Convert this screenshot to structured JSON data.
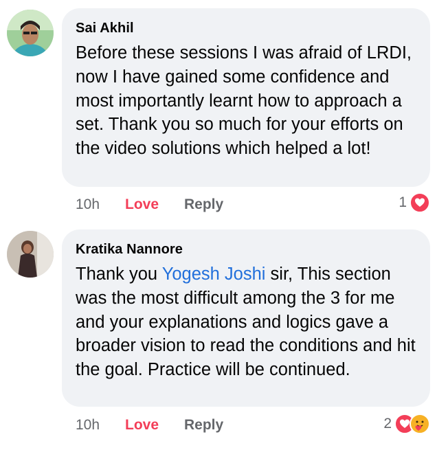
{
  "comments": [
    {
      "author": "Sai Akhil",
      "text": "Before these sessions I was afraid of LRDI, now I have gained some confidence and most importantly learnt how to approach a set. Thank you so much for your efforts on the video solutions which helped a lot!",
      "time": "10h",
      "love_label": "Love",
      "reply_label": "Reply",
      "reaction_count": "1",
      "reactions": [
        "heart-icon"
      ]
    },
    {
      "author": "Kratika Nannore",
      "text_before": "Thank you ",
      "mention": "Yogesh Joshi",
      "text_after": " sir, This section was the most difficult among the 3 for me and your explanations and logics gave a broader vision to read the conditions and hit the goal. Practice will be continued.",
      "time": "10h",
      "love_label": "Love",
      "reply_label": "Reply",
      "reaction_count": "2",
      "reactions": [
        "heart-icon",
        "care-icon"
      ]
    }
  ],
  "colors": {
    "bubble": "#f0f2f5",
    "love": "#f33e58",
    "mention": "#216fdb",
    "meta": "#65676b"
  }
}
